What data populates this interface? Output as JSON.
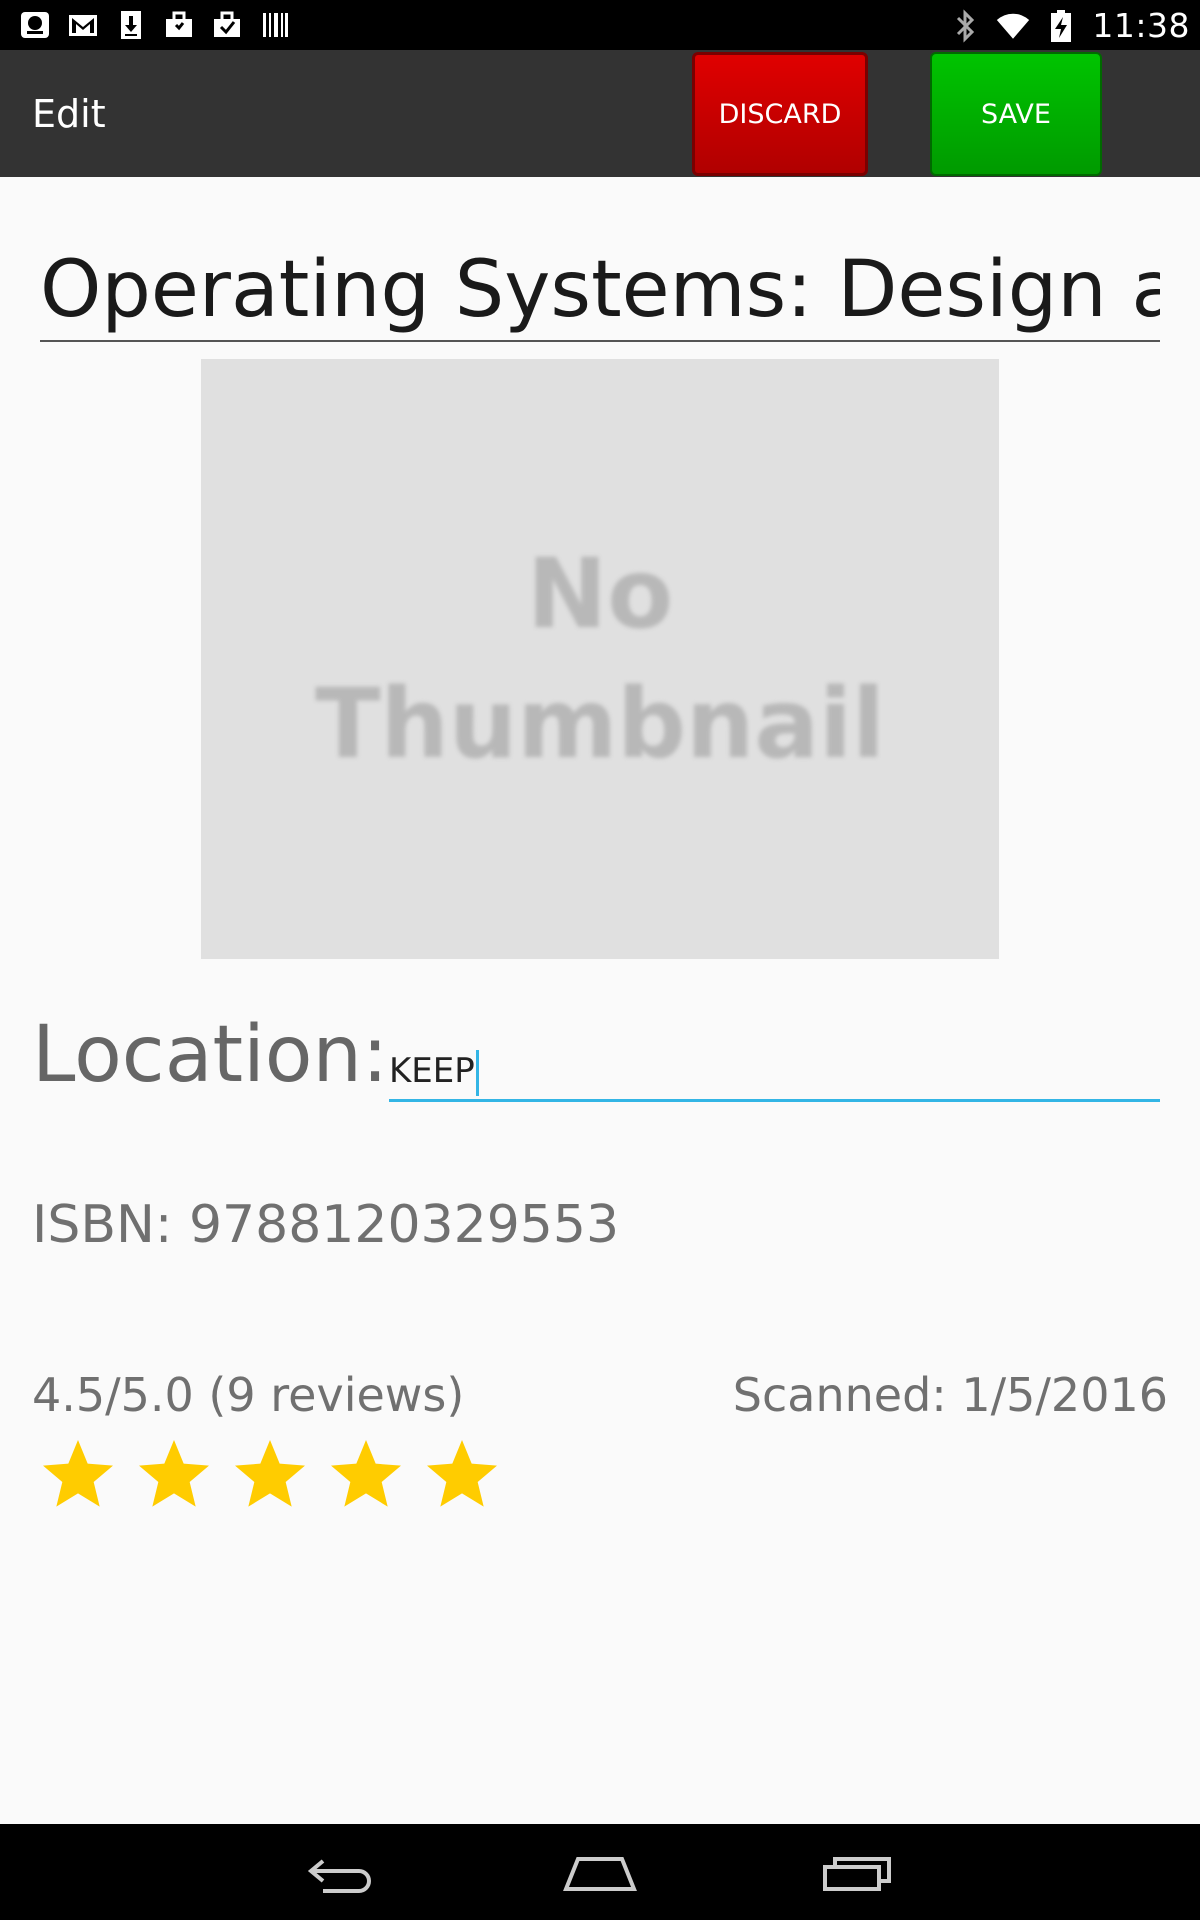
{
  "status_bar": {
    "time": "11:38",
    "notification_icons": [
      "app-icon",
      "gmail-icon",
      "download-icon",
      "briefcase-icon",
      "checkmark-bag-icon",
      "barcode-icon"
    ],
    "system_icons": [
      "bluetooth-icon",
      "wifi-icon",
      "battery-charging-icon"
    ]
  },
  "action_bar": {
    "title": "Edit",
    "discard_label": "DISCARD",
    "save_label": "SAVE",
    "discard_color": "#d40000",
    "save_color": "#00b000"
  },
  "book": {
    "title": "Operating Systems: Design and",
    "thumbnail_placeholder_line1": "No",
    "thumbnail_placeholder_line2": "Thumbnail",
    "location_label": "Location:",
    "location_value": "KEEP",
    "isbn": "ISBN: 9788120329553",
    "rating_text": "4.5/5.0 (9 reviews)",
    "rating_value": 4.5,
    "rating_max": 5,
    "scanned": "Scanned: 1/5/2016"
  },
  "accent_color": "#33b5e5",
  "star_color": "#ffcc00",
  "nav_bar": {
    "buttons": [
      "back-icon",
      "home-icon",
      "recent-apps-icon"
    ]
  }
}
